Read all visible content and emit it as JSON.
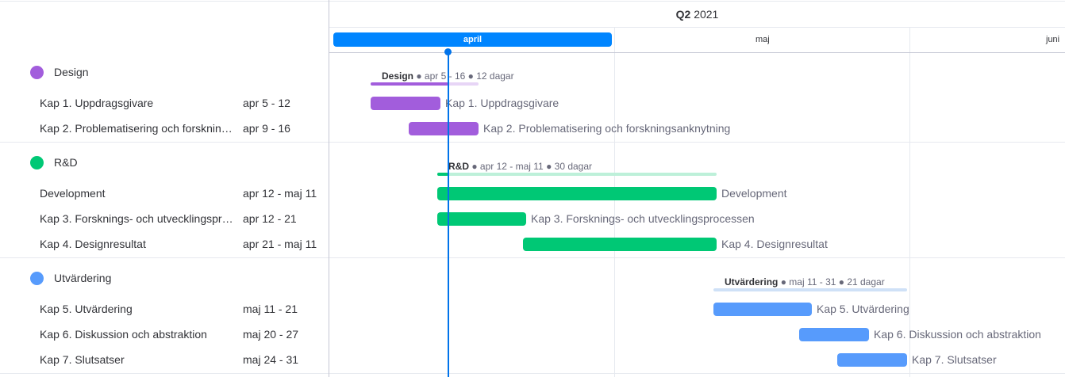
{
  "header": {
    "quarter_bold": "Q2",
    "quarter_year": "2021",
    "months": {
      "april": "april",
      "may": "maj",
      "june": "juni"
    }
  },
  "groups": [
    {
      "name": "Design",
      "color": "#a25ddc",
      "summary": {
        "title": "Design",
        "rest": " ● apr 5 - 16 ● 12 dagar"
      },
      "tasks": [
        {
          "name": "Kap 1. Uppdragsgivare",
          "dates": "apr 5 - 12",
          "label": "Kap 1. Uppdragsgivare"
        },
        {
          "name": "Kap 2. Problematisering och forskningsanknytning",
          "dates": "apr 9 - 16",
          "label": "Kap 2. Problematisering och forskningsanknytning"
        }
      ]
    },
    {
      "name": "R&D",
      "color": "#00c875",
      "summary": {
        "title": "R&D",
        "rest": " ● apr 12 - maj 11 ● 30 dagar"
      },
      "tasks": [
        {
          "name": "Development",
          "dates": "apr 12 - maj 11",
          "label": "Development"
        },
        {
          "name": "Kap 3. Forsknings- och utvecklingsprocessen",
          "dates": "apr 12 - 21",
          "label": "Kap 3. Forsknings- och utvecklingsprocessen"
        },
        {
          "name": "Kap 4. Designresultat",
          "dates": "apr 21 - maj 11",
          "label": "Kap 4. Designresultat"
        }
      ]
    },
    {
      "name": "Utvärdering",
      "color": "#579bfc",
      "summary": {
        "title": "Utvärdering",
        "rest": " ● maj 11 - 31 ● 21 dagar"
      },
      "tasks": [
        {
          "name": "Kap 5. Utvärdering",
          "dates": "maj 11 - 21",
          "label": "Kap 5. Utvärdering"
        },
        {
          "name": "Kap 6. Diskussion och abstraktion",
          "dates": "maj 20 - 27",
          "label": "Kap 6. Diskussion och abstraktion"
        },
        {
          "name": "Kap 7. Slutsatser",
          "dates": "maj 24 - 31",
          "label": "Kap 7. Slutsatser"
        }
      ]
    }
  ]
}
